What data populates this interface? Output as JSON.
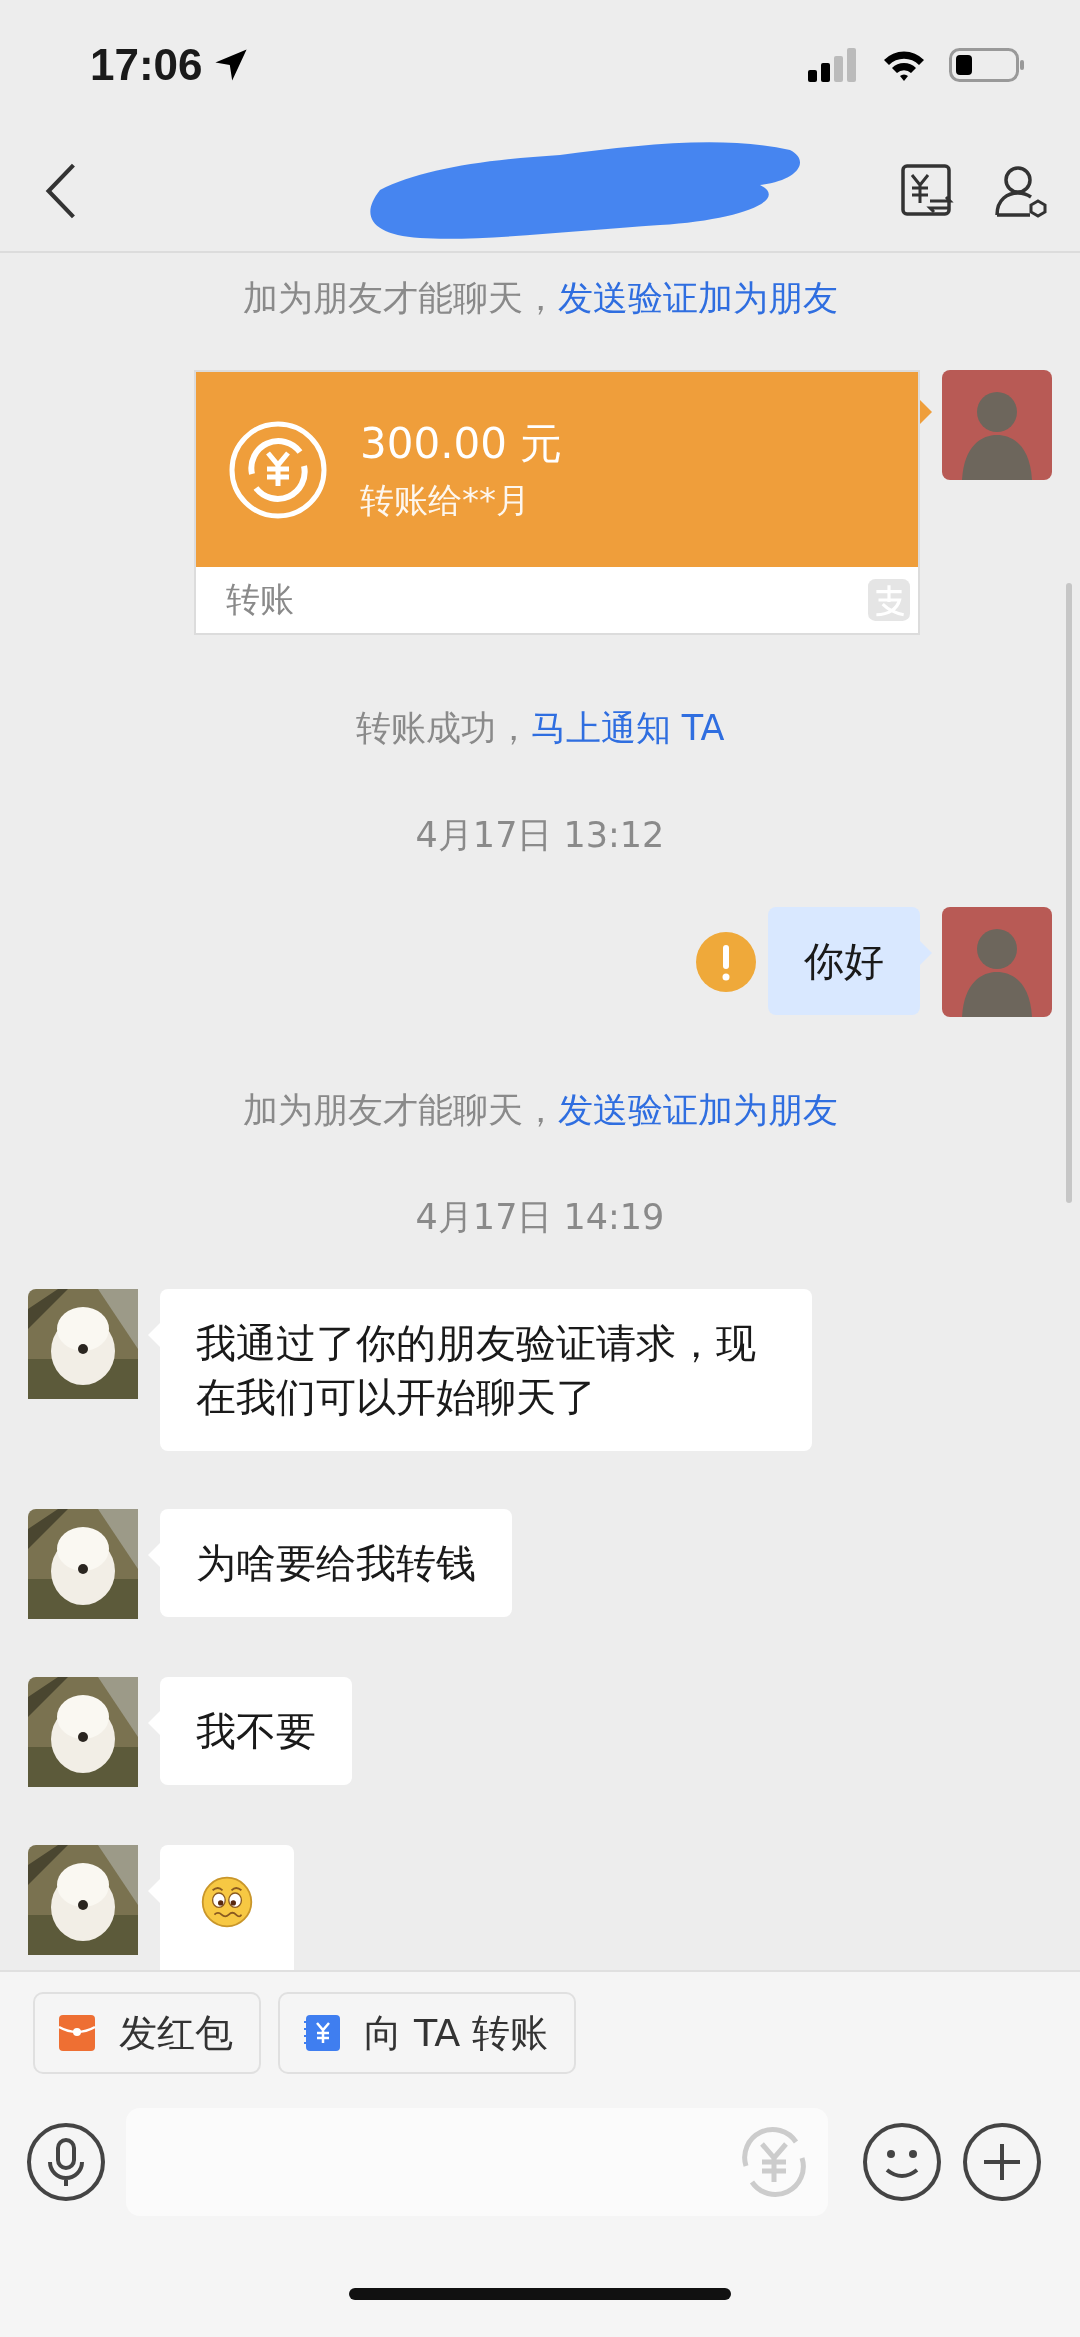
{
  "status_bar": {
    "time": "17:06"
  },
  "messages": [
    {
      "kind": "system",
      "text": "加为朋友才能聊天，",
      "link": "发送验证加为朋友"
    },
    {
      "kind": "transfer",
      "mine": true,
      "amount": "300.00 元",
      "note": "转账给**月",
      "footer": "转账"
    },
    {
      "kind": "system",
      "text": "转账成功，",
      "link": "马上通知 TA"
    },
    {
      "kind": "time",
      "text": "4月17日 13:12"
    },
    {
      "kind": "text",
      "mine": true,
      "failed": true,
      "text": "你好"
    },
    {
      "kind": "system",
      "text": "加为朋友才能聊天，",
      "link": "发送验证加为朋友"
    },
    {
      "kind": "time",
      "text": "4月17日 14:19"
    },
    {
      "kind": "text",
      "mine": false,
      "text": "我通过了你的朋友验证请求，现在我们可以开始聊天了"
    },
    {
      "kind": "text",
      "mine": false,
      "text": "为啥要给我转钱"
    },
    {
      "kind": "text",
      "mine": false,
      "text": "我不要"
    },
    {
      "kind": "emoji",
      "mine": false
    }
  ],
  "quick_actions": [
    {
      "kind": "red_packet",
      "label": "发红包"
    },
    {
      "kind": "transfer",
      "label": "向 TA 转账"
    }
  ]
}
